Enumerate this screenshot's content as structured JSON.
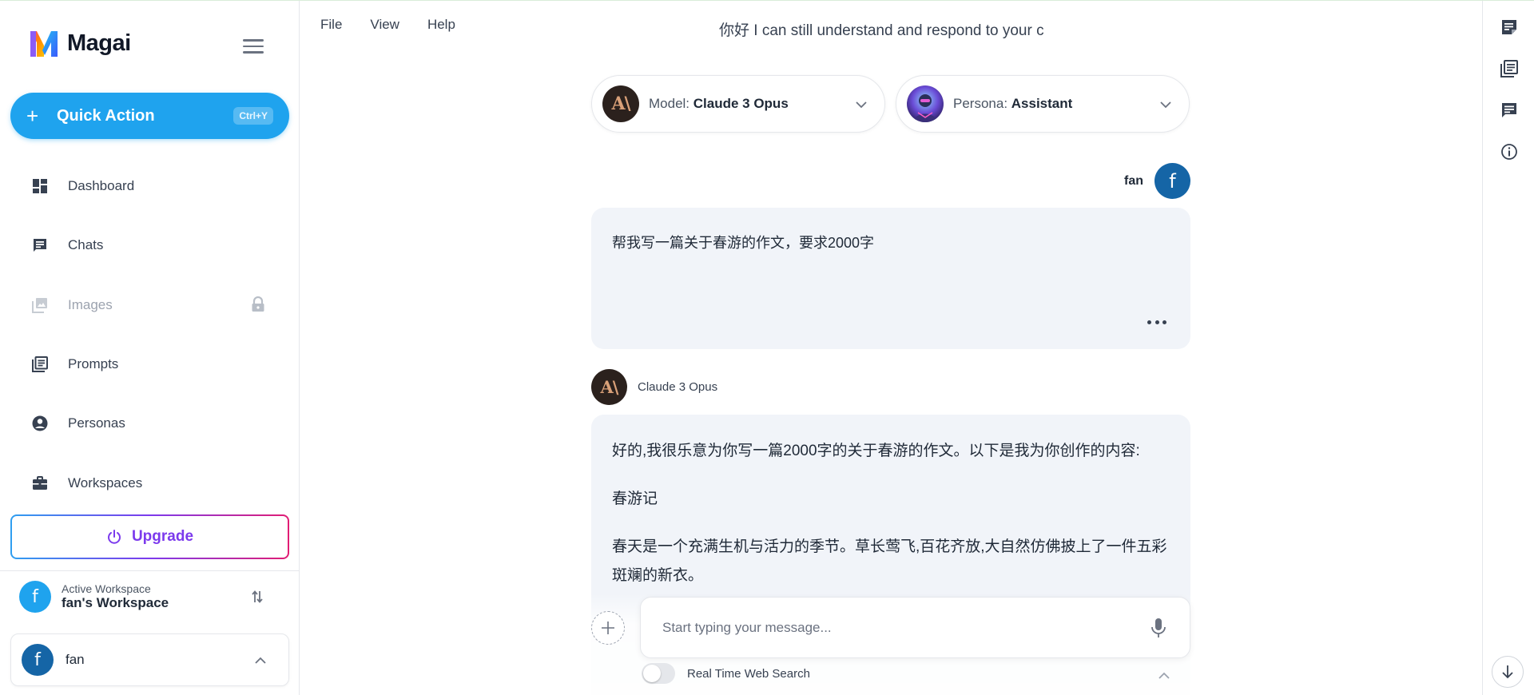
{
  "app": {
    "brand_name": "Magai",
    "chat_title": "你好 I can still understand and respond to your c"
  },
  "menu": [
    "File",
    "View",
    "Help"
  ],
  "sidebar": {
    "quick_action": {
      "label": "Quick Action",
      "shortcut": "Ctrl+Y"
    },
    "items": [
      {
        "label": "Dashboard",
        "icon": "dashboard-icon"
      },
      {
        "label": "Chats",
        "icon": "chat-icon"
      },
      {
        "label": "Images",
        "icon": "image-icon",
        "locked": true
      },
      {
        "label": "Prompts",
        "icon": "prompts-icon"
      },
      {
        "label": "Personas",
        "icon": "person-icon"
      },
      {
        "label": "Workspaces",
        "icon": "briefcase-icon"
      }
    ],
    "upgrade_label": "Upgrade",
    "workspace": {
      "sub": "Active Workspace",
      "name": "fan's Workspace",
      "avatar_letter": "f"
    },
    "user": {
      "name": "fan",
      "avatar_letter": "f"
    }
  },
  "selectors": {
    "model": {
      "prefix": "Model: ",
      "value": "Claude 3 Opus",
      "avatar_text": "A\\"
    },
    "persona": {
      "prefix": "Persona: ",
      "value": "Assistant"
    }
  },
  "conversation": {
    "user": {
      "name": "fan",
      "avatar_letter": "f",
      "message": "帮我写一篇关于春游的作文，要求2000字"
    },
    "assistant": {
      "name": "Claude 3 Opus",
      "avatar_text": "A\\",
      "paragraphs": [
        "好的,我很乐意为你写一篇2000字的关于春游的作文。以下是我为你创作的内容:",
        "春游记",
        "春天是一个充满生机与活力的季节。草长莺飞,百花齐放,大自然仿佛披上了一件五彩斑斓的新衣。"
      ]
    }
  },
  "composer": {
    "placeholder": "Start typing your message...",
    "value": "",
    "web_search_label": "Real Time Web Search",
    "web_search_enabled": false
  },
  "colors": {
    "accent": "#1fa3ee",
    "upgrade_text": "#7c3aed",
    "avatar_blue": "#1565a6",
    "workspace_avatar": "#1fa3ee",
    "bubble_bg": "#f1f4f9"
  }
}
